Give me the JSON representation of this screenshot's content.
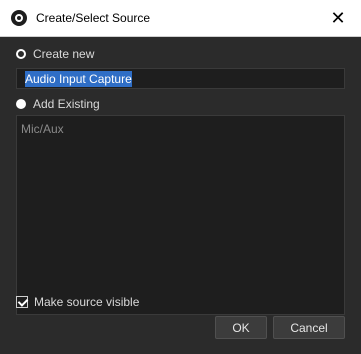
{
  "window": {
    "title": "Create/Select Source",
    "close_icon": "close-icon"
  },
  "create_new": {
    "label": "Create new",
    "name_value": "Audio Input Capture"
  },
  "add_existing": {
    "label": "Add Existing",
    "items": [
      "Mic/Aux"
    ]
  },
  "options": {
    "visible_label": "Make source visible"
  },
  "buttons": {
    "ok": "OK",
    "cancel": "Cancel"
  }
}
